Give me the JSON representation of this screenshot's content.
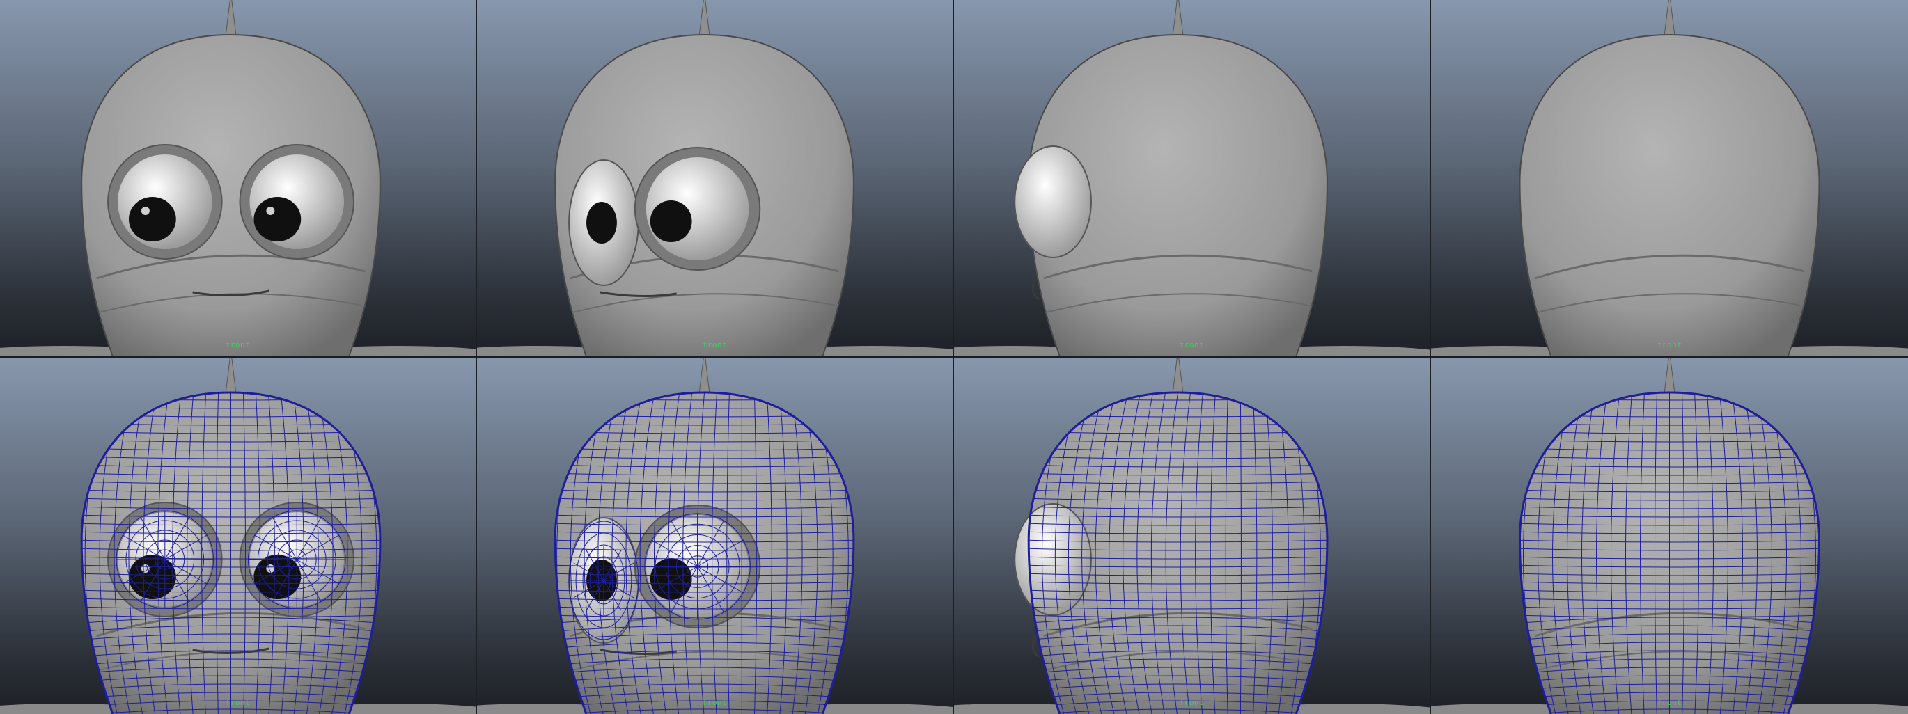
{
  "viewports": [
    {
      "camera": "front",
      "view": "front",
      "mode": "shaded"
    },
    {
      "camera": "front",
      "view": "three-quarter",
      "mode": "shaded"
    },
    {
      "camera": "front",
      "view": "side",
      "mode": "shaded"
    },
    {
      "camera": "front",
      "view": "back",
      "mode": "shaded"
    },
    {
      "camera": "front",
      "view": "front",
      "mode": "wireframe-on-shaded"
    },
    {
      "camera": "front",
      "view": "three-quarter",
      "mode": "wireframe-on-shaded"
    },
    {
      "camera": "front",
      "view": "side",
      "mode": "wireframe-on-shaded"
    },
    {
      "camera": "front",
      "view": "back",
      "mode": "wireframe-on-shaded"
    }
  ],
  "colors": {
    "background_top": "#8797ad",
    "background_bottom": "#1d2026",
    "model": "#9a9a9a",
    "wireframe": "#1e1e9c",
    "camera_label": "#3fd05a"
  }
}
